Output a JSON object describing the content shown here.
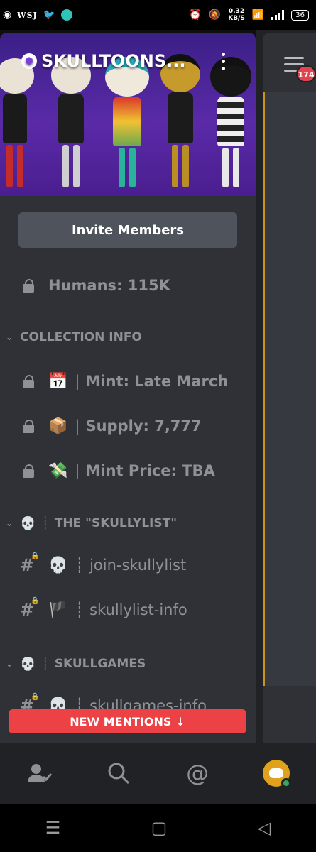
{
  "status_bar": {
    "wsj": "WSJ",
    "speed_value": "0.32",
    "speed_unit": "KB/S",
    "battery": "36"
  },
  "server": {
    "name": "SKULLTOONS...",
    "invite_label": "Invite Members",
    "humans_label": "Humans: 115K"
  },
  "categories": {
    "collection_info": "COLLECTION INFO",
    "skullylist": "THE \"SKULLYLIST\"",
    "skullgames": "SKULLGAMES"
  },
  "channels": {
    "mint_date": {
      "emoji": "📅",
      "label": "Mint: Late March"
    },
    "supply": {
      "emoji": "📦",
      "label": "Supply: 7,777"
    },
    "mint_price": {
      "emoji": "💸",
      "label": "Mint Price: TBA"
    },
    "join_skullylist": {
      "emoji": "💀",
      "label": "join-skullylist"
    },
    "skullylist_info": {
      "emoji": "🏴",
      "label": "skullylist-info"
    },
    "skullgames_info": {
      "emoji": "💀",
      "label": "skullgames-info"
    }
  },
  "category_emoji": "💀",
  "mentions_label": "NEW MENTIONS",
  "peek": {
    "badge": "174"
  },
  "tabs": [
    "friends-icon",
    "search-icon",
    "mentions-icon",
    "profile-avatar"
  ],
  "colors": {
    "accent_red": "#ed4245",
    "online": "#3ba55d",
    "avatar": "#e0a11b"
  }
}
